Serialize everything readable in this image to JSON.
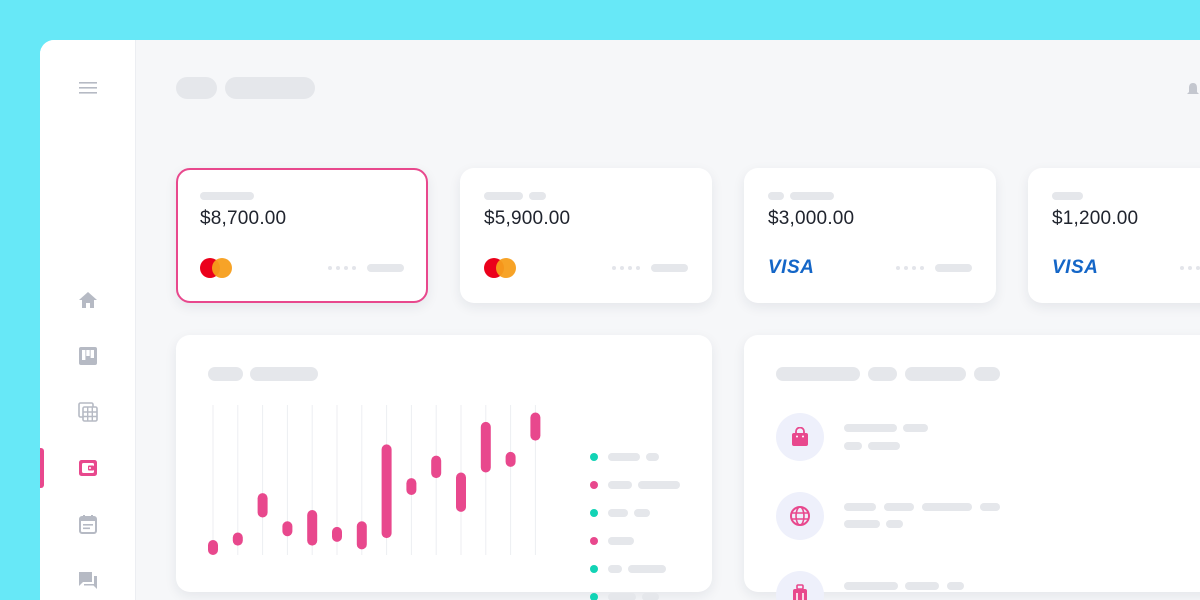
{
  "colors": {
    "background": "#67e8f7",
    "accent": "#e8488d",
    "teal": "#12d3b5",
    "visa_blue": "#1466c7"
  },
  "sidebar": {
    "items": [
      {
        "name": "menu",
        "icon": "menu-icon",
        "active": false
      },
      {
        "name": "home",
        "icon": "home-icon",
        "active": false
      },
      {
        "name": "board",
        "icon": "board-icon",
        "active": false
      },
      {
        "name": "gallery",
        "icon": "gallery-icon",
        "active": false
      },
      {
        "name": "wallet",
        "icon": "wallet-icon",
        "active": true
      },
      {
        "name": "calendar",
        "icon": "calendar-icon",
        "active": false
      },
      {
        "name": "chat",
        "icon": "chat-icon",
        "active": false
      }
    ]
  },
  "cards": [
    {
      "amount": "$8,700.00",
      "brand": "mastercard",
      "selected": true
    },
    {
      "amount": "$5,900.00",
      "brand": "mastercard",
      "selected": false
    },
    {
      "amount": "$3,000.00",
      "brand": "visa",
      "brand_label": "VISA",
      "selected": false
    },
    {
      "amount": "$1,200.00",
      "brand": "visa",
      "brand_label": "VISA",
      "selected": false
    }
  ],
  "chart_data": {
    "type": "candlestick",
    "title": "",
    "xlabel": "",
    "ylabel": "",
    "grid": true,
    "ranges": [
      [
        0,
        8
      ],
      [
        5,
        12
      ],
      [
        20,
        33
      ],
      [
        10,
        18
      ],
      [
        5,
        24
      ],
      [
        7,
        15
      ],
      [
        3,
        18
      ],
      [
        9,
        59
      ],
      [
        32,
        41
      ],
      [
        41,
        53
      ],
      [
        23,
        44
      ],
      [
        44,
        71
      ],
      [
        47,
        55
      ],
      [
        61,
        76
      ]
    ],
    "yrange": [
      0,
      80
    ],
    "legend": [
      "teal",
      "pink",
      "teal",
      "pink",
      "teal",
      "teal"
    ]
  },
  "transactions": {
    "items": [
      {
        "icon": "shopping-bag-icon"
      },
      {
        "icon": "globe-icon"
      },
      {
        "icon": "luggage-icon"
      }
    ]
  }
}
